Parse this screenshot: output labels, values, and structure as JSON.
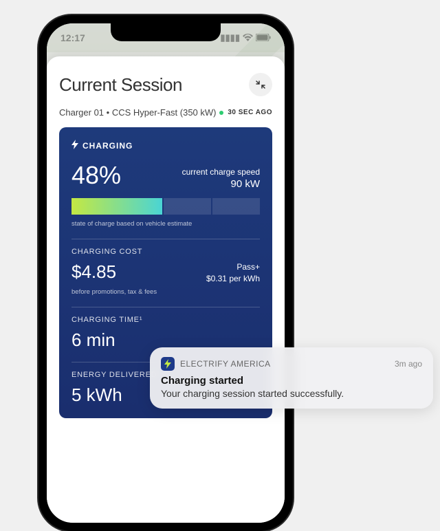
{
  "status": {
    "time": "12:17",
    "signal_icon": "signal",
    "wifi_icon": "wifi",
    "battery_icon": "battery"
  },
  "sheet": {
    "title": "Current Session",
    "collapse_icon": "collapse-icon",
    "subtitle": "Charger 01 • CCS Hyper-Fast (350 kW)",
    "updated_ago": "30 SEC AGO"
  },
  "charging": {
    "label": "CHARGING",
    "bolt_icon": "bolt-icon",
    "soc_pct": "48%",
    "speed_label": "current charge speed",
    "speed_value": "90 kW",
    "soc_note": "state of charge based on vehicle estimate"
  },
  "cost": {
    "label": "CHARGING COST",
    "value": "$4.85",
    "note": "before promotions, tax & fees",
    "plan_name": "Pass+",
    "plan_rate": "$0.31 per kWh"
  },
  "time_section": {
    "label": "CHARGING TIME¹",
    "value": "6 min"
  },
  "energy_section": {
    "label": "ENERGY DELIVERED²",
    "value": "5 kWh"
  },
  "notification": {
    "app": "ELECTRIFY AMERICA",
    "ago": "3m ago",
    "title": "Charging started",
    "body": "Your charging session started successfully."
  }
}
